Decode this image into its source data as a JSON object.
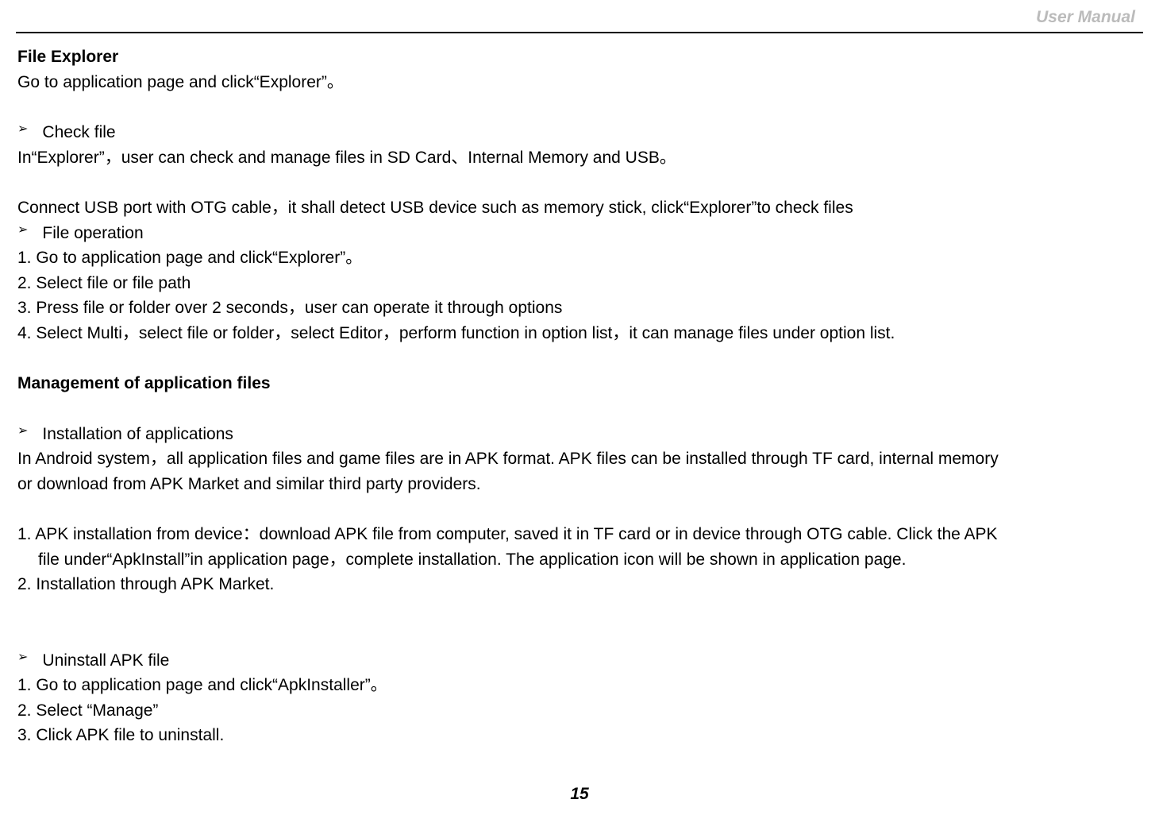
{
  "header": {
    "title": "User Manual"
  },
  "section1": {
    "title": "File Explorer",
    "intro": "Go to application page and click“Explorer”。",
    "bullet1": "Check file",
    "line1": "In“Explorer”，user can check and manage files in SD Card、Internal Memory and USB。",
    "line2": "Connect USB port with OTG cable，it shall detect USB device such as memory stick, click“Explorer”to check files",
    "bullet2": "File operation",
    "step1": "1. Go to application page and click“Explorer”。",
    "step2": "2. Select file or file path",
    "step3": "3. Press file or folder over 2 seconds，user can operate it through options",
    "step4": "4. Select Multi，select file or folder，select Editor，perform function in option list，it can manage files under option list."
  },
  "section2": {
    "title": "Management of application files",
    "bullet1": "Installation of applications",
    "line1": "In Android system，all application files and game files are in APK format. APK files can be installed through TF card, internal memory",
    "line2": " or download from APK Market and similar third party providers.",
    "step1a": "1. APK installation from device：download APK file from computer, saved it in TF card or in device through OTG cable. Click the APK",
    "step1b": "file under“ApkInstall”in application page，complete installation. The application icon will be shown in application page.",
    "step2": "2. Installation through APK Market.",
    "bullet2": "Uninstall APK file",
    "ustep1": "1. Go to application page and click“ApkInstaller”。",
    "ustep2": "2. Select “Manage”",
    "ustep3": "3. Click APK file to uninstall."
  },
  "pageNumber": "15"
}
